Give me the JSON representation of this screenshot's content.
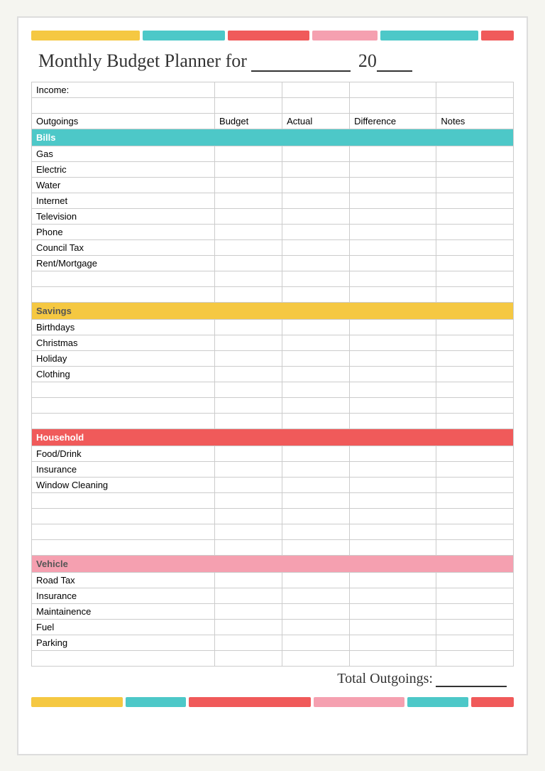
{
  "page": {
    "title": "Monthly Budget Planner for",
    "title_blank": "___________",
    "year_prefix": "20",
    "year_blank": "__",
    "total_label": "Total Outgoings:",
    "total_blank": "______"
  },
  "header": {
    "col_outgoings": "Outgoings",
    "col_budget": "Budget",
    "col_actual": "Actual",
    "col_difference": "Difference",
    "col_notes": "Notes"
  },
  "sections": {
    "bills": {
      "label": "Bills",
      "rows": [
        "Gas",
        "Electric",
        "Water",
        "Internet",
        "Television",
        "Phone",
        "Council Tax",
        "Rent/Mortgage",
        ""
      ]
    },
    "savings": {
      "label": "Savings",
      "rows": [
        "Birthdays",
        "Christmas",
        "Holiday",
        "Clothing",
        "",
        ""
      ]
    },
    "household": {
      "label": "Household",
      "rows": [
        "Food/Drink",
        "Insurance",
        "Window Cleaning",
        "",
        "",
        ""
      ]
    },
    "vehicle": {
      "label": "Vehicle",
      "rows": [
        "Road Tax",
        "Insurance",
        "Maintainence",
        "Fuel",
        "Parking",
        ""
      ]
    }
  },
  "income_label": "Income:"
}
